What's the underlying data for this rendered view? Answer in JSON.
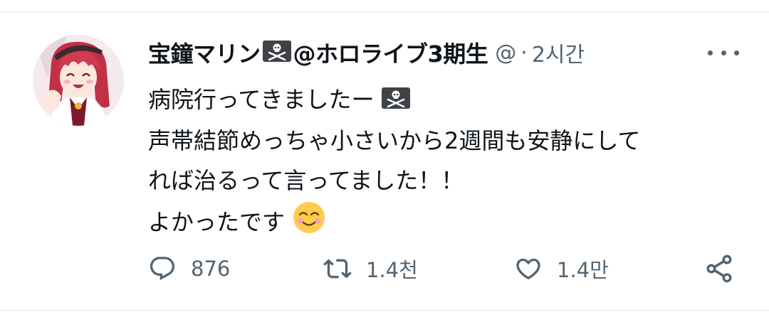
{
  "tweet": {
    "display_name": "宝鐘マリン",
    "display_name_suffix": "@ホロライブ3期生",
    "handle": "@",
    "separator": "·",
    "time": "2시간",
    "lines": [
      "病院行ってきましたー",
      "声帯結節めっちゃ小さいから2週間も安静にして",
      "れば治るって言ってました！！",
      "よかったです"
    ]
  },
  "actions": {
    "reply_count": "876",
    "retweet_count": "1.4천",
    "like_count": "1.4만"
  },
  "icons": {
    "name_flag": "pirate-flag-icon",
    "line1_flag": "pirate-flag-icon",
    "smile": "smiling-face-emoji",
    "more": "more-options-icon",
    "reply": "reply-icon",
    "retweet": "retweet-icon",
    "like": "heart-icon",
    "share": "share-icon"
  },
  "colors": {
    "text": "#0f1419",
    "muted": "#536471",
    "divider": "#eff3f4"
  }
}
